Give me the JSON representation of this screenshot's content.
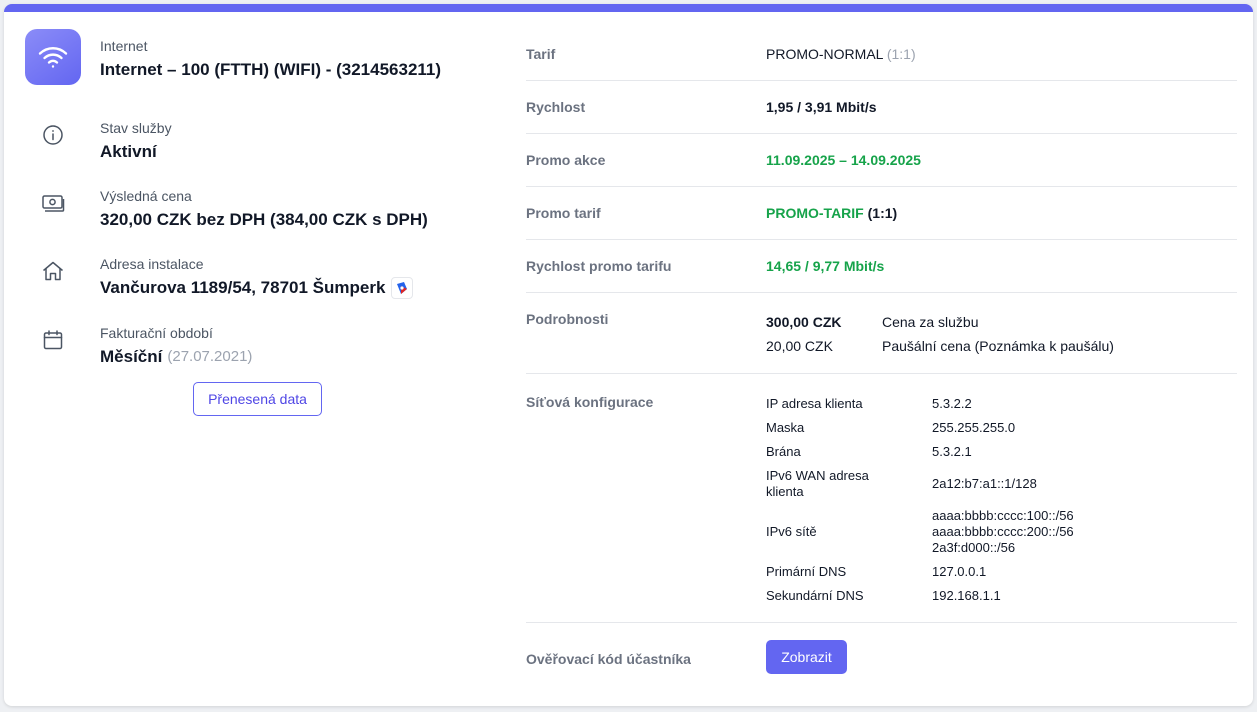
{
  "service": {
    "type_label": "Internet",
    "name": "Internet – 100 (FTTH) (WIFI) - (3214563211)"
  },
  "status": {
    "label": "Stav služby",
    "value": "Aktivní"
  },
  "price": {
    "label": "Výsledná cena",
    "value": "320,00 CZK bez DPH (384,00 CZK s DPH)"
  },
  "address": {
    "label": "Adresa instalace",
    "value": "Vančurova 1189/54, 78701 Šumperk"
  },
  "billing": {
    "label": "Fakturační období",
    "value": "Měsíční",
    "date": "(27.07.2021)"
  },
  "transferred_button": "Přenesená data",
  "tariff": {
    "label": "Tarif",
    "value": "PROMO-NORMAL",
    "ratio": "(1:1)"
  },
  "speed": {
    "label": "Rychlost",
    "value": "1,95 / 3,91 Mbit/s"
  },
  "promo_action": {
    "label": "Promo akce",
    "value": "11.09.2025 – 14.09.2025"
  },
  "promo_tariff": {
    "label": "Promo tarif",
    "value": "PROMO-TARIF",
    "ratio": "(1:1)"
  },
  "promo_speed": {
    "label": "Rychlost promo tarifu",
    "value": "14,65 / 9,77 Mbit/s"
  },
  "details": {
    "label": "Podrobnosti",
    "items": [
      {
        "amount": "300,00 CZK",
        "desc": "Cena za službu"
      },
      {
        "amount": "20,00 CZK",
        "desc": "Paušální cena (Poznámka k paušálu)"
      }
    ]
  },
  "network": {
    "label": "Síťová konfigurace",
    "items": [
      {
        "key": "IP adresa klienta",
        "value": "5.3.2.2"
      },
      {
        "key": "Maska",
        "value": "255.255.255.0"
      },
      {
        "key": "Brána",
        "value": "5.3.2.1"
      },
      {
        "key": "IPv6 WAN adresa klienta",
        "value": "2a12:b7:a1::1/128"
      },
      {
        "key": "IPv6 sítě",
        "value_lines": [
          "aaaa:bbbb:cccc:100::/56",
          "aaaa:bbbb:cccc:200::/56",
          "2a3f:d000::/56"
        ]
      },
      {
        "key": "Primární DNS",
        "value": "127.0.0.1"
      },
      {
        "key": "Sekundární DNS",
        "value": "192.168.1.1"
      }
    ]
  },
  "verification": {
    "label": "Ověřovací kód účastníka",
    "button": "Zobrazit"
  },
  "colors": {
    "accent": "#6366f1",
    "promo_green": "#16a34a"
  }
}
